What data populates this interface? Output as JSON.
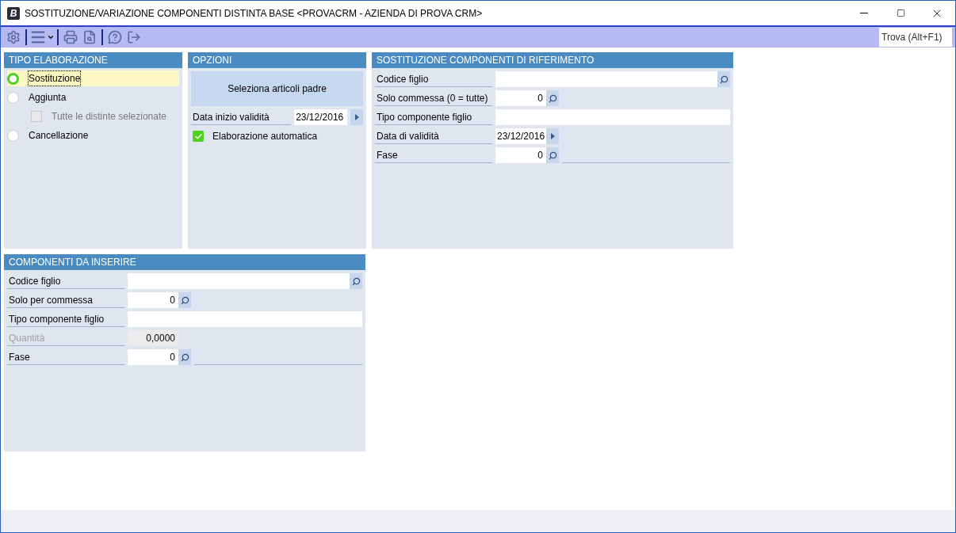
{
  "window": {
    "title": "SOSTITUZIONE/VARIAZIONE COMPONENTI DISTINTA BASE <PROVACRM - AZIENDA DI PROVA CRM>",
    "app_logo": "B"
  },
  "toolbar": {
    "search": {
      "placeholder": "Trova (Alt+F1)"
    }
  },
  "tipo": {
    "title": "TIPO ELABORAZIONE",
    "options": [
      {
        "label": "Sostituzione",
        "selected": true
      },
      {
        "label": "Aggiunta",
        "selected": false,
        "sub": {
          "label": "Tutte le distinte selezionate",
          "checked": false,
          "disabled": true
        }
      },
      {
        "label": "Cancellazione",
        "selected": false
      }
    ]
  },
  "opzioni": {
    "title": "OPZIONI",
    "button": "Seleziona articoli padre",
    "date": {
      "label": "Data inizio validità",
      "value": "23/12/2016"
    },
    "auto": {
      "label": "Elaborazione automatica",
      "checked": true
    }
  },
  "riferimento": {
    "title": "SOSTITUZIONE COMPONENTI DI RIFERIMENTO",
    "fields": [
      {
        "kind": "lookup",
        "label": "Codice figlio",
        "disabled": false
      },
      {
        "kind": "code",
        "label": "Solo commessa (0 = tutte)",
        "value": "0",
        "disabled": false
      },
      {
        "kind": "text",
        "label": "Tipo componente figlio",
        "disabled": false
      },
      {
        "kind": "date",
        "label": "Data di validità",
        "value": "23/12/2016",
        "disabled": false
      },
      {
        "kind": "phase",
        "label": "Fase",
        "value": "0",
        "disabled": false
      }
    ]
  },
  "inserire": {
    "title": "COMPONENTI DA INSERIRE",
    "fields": [
      {
        "kind": "lookup",
        "label": "Codice figlio",
        "disabled": false
      },
      {
        "kind": "code",
        "label": "Solo per commessa",
        "value": "0",
        "disabled": false
      },
      {
        "kind": "text",
        "label": "Tipo componente figlio",
        "disabled": false
      },
      {
        "kind": "number",
        "label": "Quantità",
        "value": "0,0000",
        "disabled": true
      },
      {
        "kind": "phase",
        "label": "Fase",
        "value": "0",
        "disabled": false
      }
    ]
  }
}
